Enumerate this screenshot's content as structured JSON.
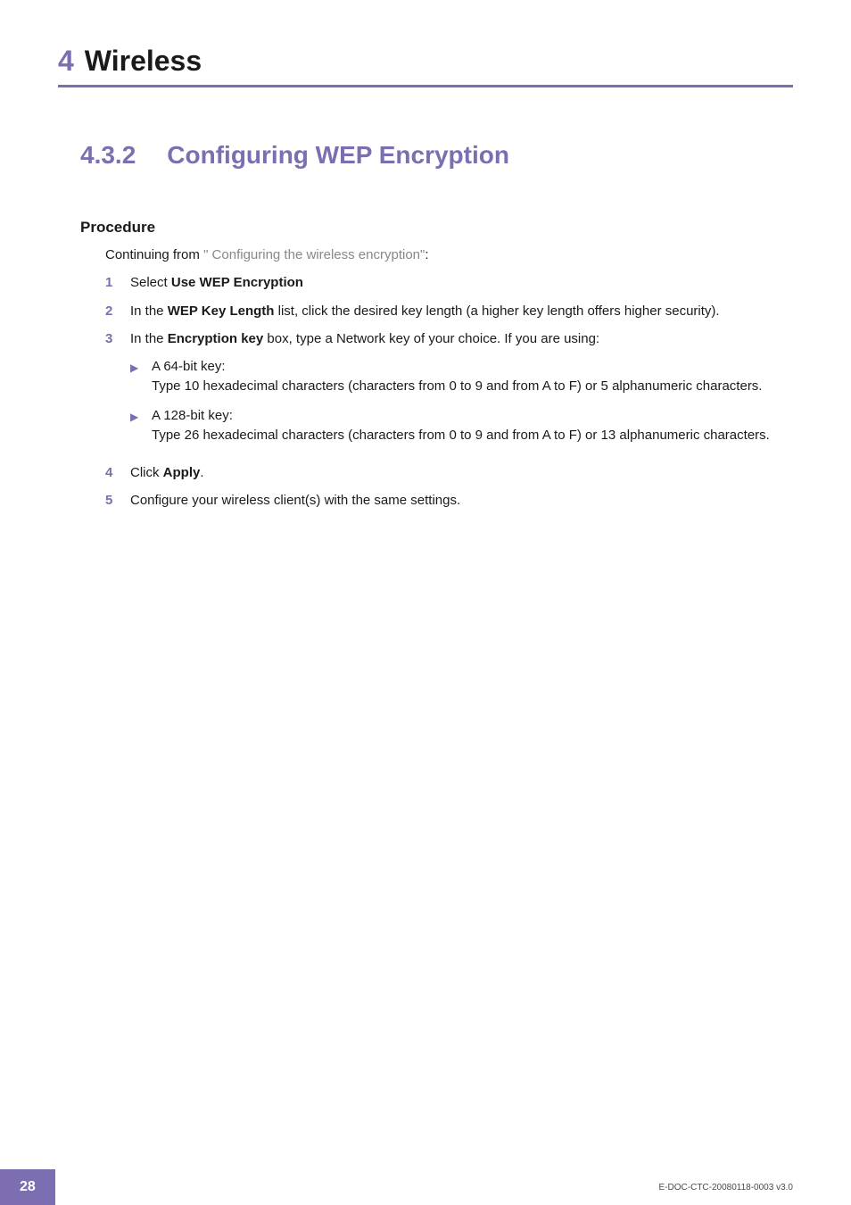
{
  "header": {
    "chapter_num": "4",
    "chapter_title": "Wireless"
  },
  "section": {
    "num": "4.3.2",
    "name": "Configuring WEP Encryption"
  },
  "procedure": {
    "heading": "Procedure",
    "intro_prefix": "Continuing from ",
    "intro_link": "\" Configuring the wireless encryption\"",
    "intro_suffix": ":",
    "steps": [
      {
        "num": "1",
        "prefix": "Select ",
        "bold": "Use WEP Encryption",
        "suffix": ""
      },
      {
        "num": "2",
        "prefix": "In the ",
        "bold": "WEP Key Length",
        "suffix": " list, click the desired key length (a higher key length offers higher security)."
      },
      {
        "num": "3",
        "prefix": "In the ",
        "bold": "Encryption key",
        "suffix": " box, type a Network key of your choice. If you are using:",
        "sublist": [
          {
            "title": "A 64-bit key:",
            "desc": "Type 10 hexadecimal characters (characters from 0 to 9 and from A to F) or 5 alphanumeric characters."
          },
          {
            "title": "A 128-bit key:",
            "desc": "Type 26 hexadecimal characters (characters from 0 to 9 and from A to F) or 13 alphanumeric characters."
          }
        ]
      },
      {
        "num": "4",
        "prefix": "Click ",
        "bold": "Apply",
        "suffix": "."
      },
      {
        "num": "5",
        "prefix": "Configure your wireless client(s) with the same settings.",
        "bold": "",
        "suffix": ""
      }
    ]
  },
  "footer": {
    "page_num": "28",
    "doc_id": "E-DOC-CTC-20080118-0003 v3.0"
  }
}
